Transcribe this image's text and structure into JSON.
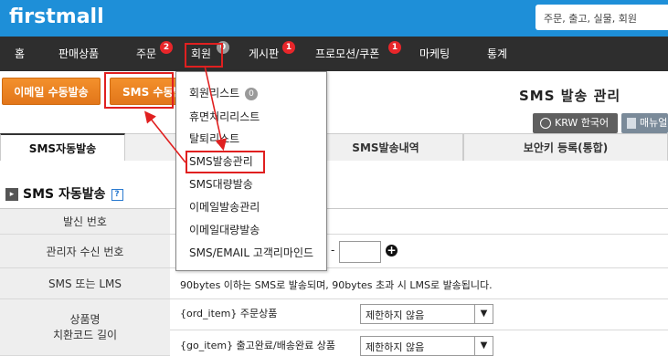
{
  "header": {
    "logo": "firstmall",
    "search_placeholder": "주문, 출고, 실물, 회원"
  },
  "nav": {
    "items": [
      {
        "label": "홈"
      },
      {
        "label": "판매상품"
      },
      {
        "label": "주문",
        "badge": "2"
      },
      {
        "label": "회원",
        "badge": "0"
      },
      {
        "label": "게시판",
        "badge": "1"
      },
      {
        "label": "프로모션/쿠폰",
        "badge": "1"
      },
      {
        "label": "마케팅"
      },
      {
        "label": "통계"
      }
    ]
  },
  "toolbar": {
    "email_btn": "이메일 수동발송",
    "sms_btn": "SMS 수동발송",
    "page_title": "SMS 발송 관리",
    "lang_btn": "KRW 한국어",
    "manual_btn": "매뉴얼"
  },
  "tabs": [
    {
      "label": "SMS자동발송"
    },
    {
      "label": "SMS발송내역"
    },
    {
      "label": "보안키 등록(통합)"
    }
  ],
  "section": {
    "title": "SMS 자동발송",
    "help": "?"
  },
  "rows": {
    "sender": {
      "label": "발신 번호"
    },
    "admin_receive": {
      "label": "관리자 수신 번호",
      "dash": "-"
    },
    "sms_lms": {
      "label": "SMS 또는 LMS",
      "text": "90bytes 이하는 SMS로 발송되며, 90bytes 초과 시 LMS로 발송됩니다."
    },
    "product_name": {
      "label_line1": "상품명",
      "label_line2": "치환코드 길이",
      "sub": [
        {
          "code": "{ord_item} 주문상품",
          "value": "제한하지 않음"
        },
        {
          "code": "{go_item} 출고완료/배송완료 상품",
          "value": "제한하지 않음"
        }
      ]
    }
  },
  "dropdown": {
    "items": [
      {
        "label": "회원리스트",
        "badge": "0"
      },
      {
        "label": "휴면처리리스트"
      },
      {
        "label": "탈퇴리스트"
      },
      {
        "label": "SMS발송관리"
      },
      {
        "label": "SMS대량발송"
      },
      {
        "label": "이메일발송관리"
      },
      {
        "label": "이메일대량발송"
      },
      {
        "label": "SMS/EMAIL 고객리마인드"
      }
    ]
  },
  "colors": {
    "topbar": "#1e8fd8",
    "nav": "#2e2e2e",
    "accent_orange": "#e8801f",
    "highlight_red": "#e02020"
  }
}
